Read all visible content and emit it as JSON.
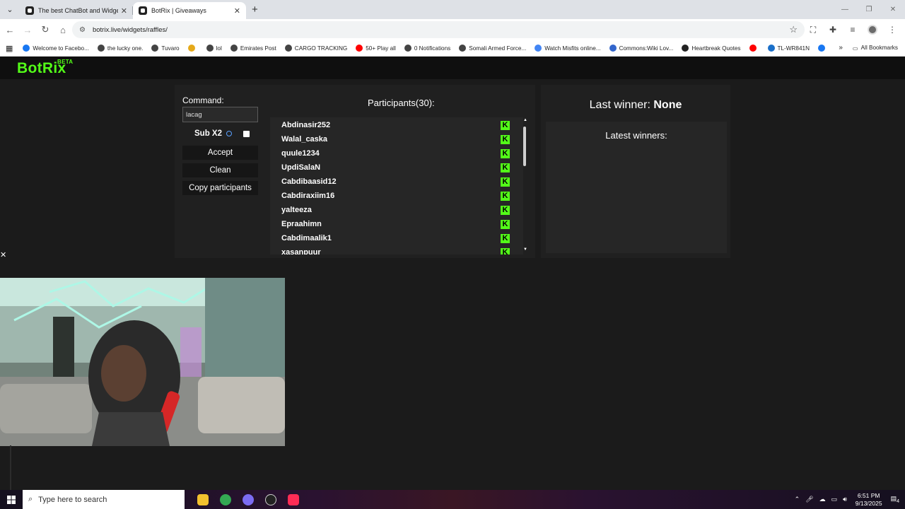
{
  "browser": {
    "tabs": [
      {
        "title": "The best ChatBot and Widgets",
        "active": false
      },
      {
        "title": "BotRix | Giveaways",
        "active": true
      }
    ],
    "url": "botrix.live/widgets/raffles/",
    "bookmarks": [
      {
        "label": "Welcome to Facebo...",
        "color": "#1877f2"
      },
      {
        "label": "the lucky one.",
        "color": "#444444"
      },
      {
        "label": "Tuvaro",
        "color": "#444444"
      },
      {
        "label": "",
        "color": "#e5a91a"
      },
      {
        "label": "lol",
        "color": "#444444"
      },
      {
        "label": "Emirates Post",
        "color": "#444444"
      },
      {
        "label": "CARGO TRACKING",
        "color": "#444444"
      },
      {
        "label": "50+ Play all",
        "color": "#ff0000"
      },
      {
        "label": "0 Notifications",
        "color": "#444444"
      },
      {
        "label": "Somali Armed Force...",
        "color": "#444444"
      },
      {
        "label": "Watch Misfits online...",
        "color": "#4285f4"
      },
      {
        "label": "Commons:Wiki Lov...",
        "color": "#3366cc"
      },
      {
        "label": "Heartbreak Quotes",
        "color": "#222222"
      },
      {
        "label": "",
        "color": "#ff0000"
      },
      {
        "label": "TL-WR841N",
        "color": "#1a6fc9"
      },
      {
        "label": "",
        "color": "#1877f2"
      }
    ],
    "all_bookmarks": "All Bookmarks"
  },
  "app": {
    "logo": "BotRix",
    "logo_badge": "BETA",
    "command_label": "Command:",
    "command_value": "lacag",
    "sub_label": "Sub X2",
    "buttons": {
      "accept": "Accept",
      "clean": "Clean",
      "copy": "Copy participants"
    },
    "participants_title": "Participants(30):",
    "participants": [
      "Abdinasir252",
      "Walal_caska",
      "quule1234",
      "UpdiSalaN",
      "Cabdibaasid12",
      "Cabdiraxiim16",
      "yalteeza",
      "Epraahimn",
      "Cabdimaalik1",
      "xasanpuur"
    ],
    "last_winner_label": "Last winner:",
    "last_winner_value": "None",
    "latest_winners_label": "Latest winners:",
    "accent_color": "#53fc18"
  },
  "taskbar": {
    "search_placeholder": "Type here to search",
    "time": "6:51 PM",
    "date": "9/13/2025",
    "notification_count": "4"
  }
}
